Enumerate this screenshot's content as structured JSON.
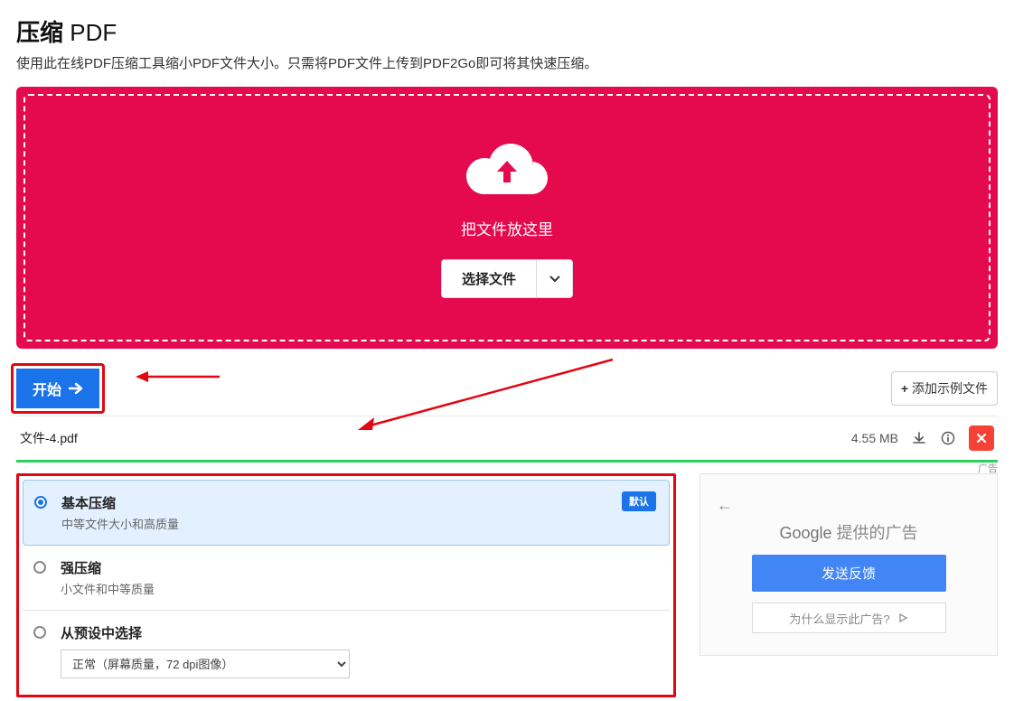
{
  "header": {
    "title_bold": "压缩",
    "title_rest": " PDF",
    "subtitle": "使用此在线PDF压缩工具缩小PDF文件大小。只需将PDF文件上传到PDF2Go即可将其快速压缩。"
  },
  "dropzone": {
    "drop_text": "把文件放这里",
    "select_file": "选择文件"
  },
  "toolbar": {
    "start_label": "开始",
    "add_sample_label": "添加示例文件"
  },
  "file": {
    "name": "文件-4.pdf",
    "size": "4.55 MB"
  },
  "options": {
    "items": [
      {
        "title": "基本压缩",
        "desc": "中等文件大小和高质量",
        "selected": true,
        "default_badge": "默认"
      },
      {
        "title": "强压缩",
        "desc": "小文件和中等质量",
        "selected": false
      },
      {
        "title": "从预设中选择",
        "selected": false,
        "preset_value": "正常（屏幕质量，72 dpi图像）"
      }
    ]
  },
  "ad": {
    "label": "广告",
    "google_text": "Google 提供的广告",
    "feedback": "发送反馈",
    "why": "为什么显示此广告?"
  }
}
